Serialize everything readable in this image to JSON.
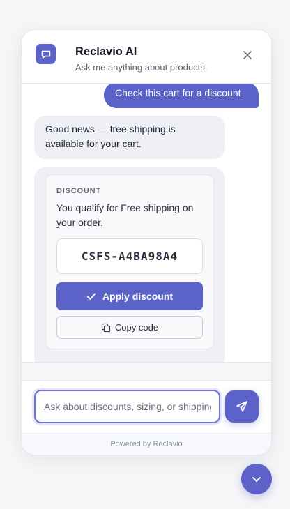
{
  "header": {
    "title": "Reclavio AI",
    "subtitle": "Ask me anything about products."
  },
  "messages": {
    "user": "Check this cart for a discount",
    "bot": "Good news — free shipping is available for your cart."
  },
  "discount_card": {
    "label": "DISCOUNT",
    "text": "You qualify for Free shipping on your order.",
    "code": "CSFS-A4BA98A4",
    "apply_label": "Apply discount",
    "copy_label": "Copy code"
  },
  "input": {
    "placeholder": "Ask about discounts, sizing, or shipping",
    "value": ""
  },
  "footer": {
    "powered_by": "Powered by Reclavio"
  },
  "colors": {
    "accent": "#5b63c8",
    "bubble_bg": "#eef0f6"
  },
  "icons": {
    "brand": "chat-bubble-icon",
    "close": "close-icon",
    "apply": "check-icon",
    "copy": "copy-icon",
    "send": "send-icon",
    "fab": "chevron-down-icon"
  }
}
